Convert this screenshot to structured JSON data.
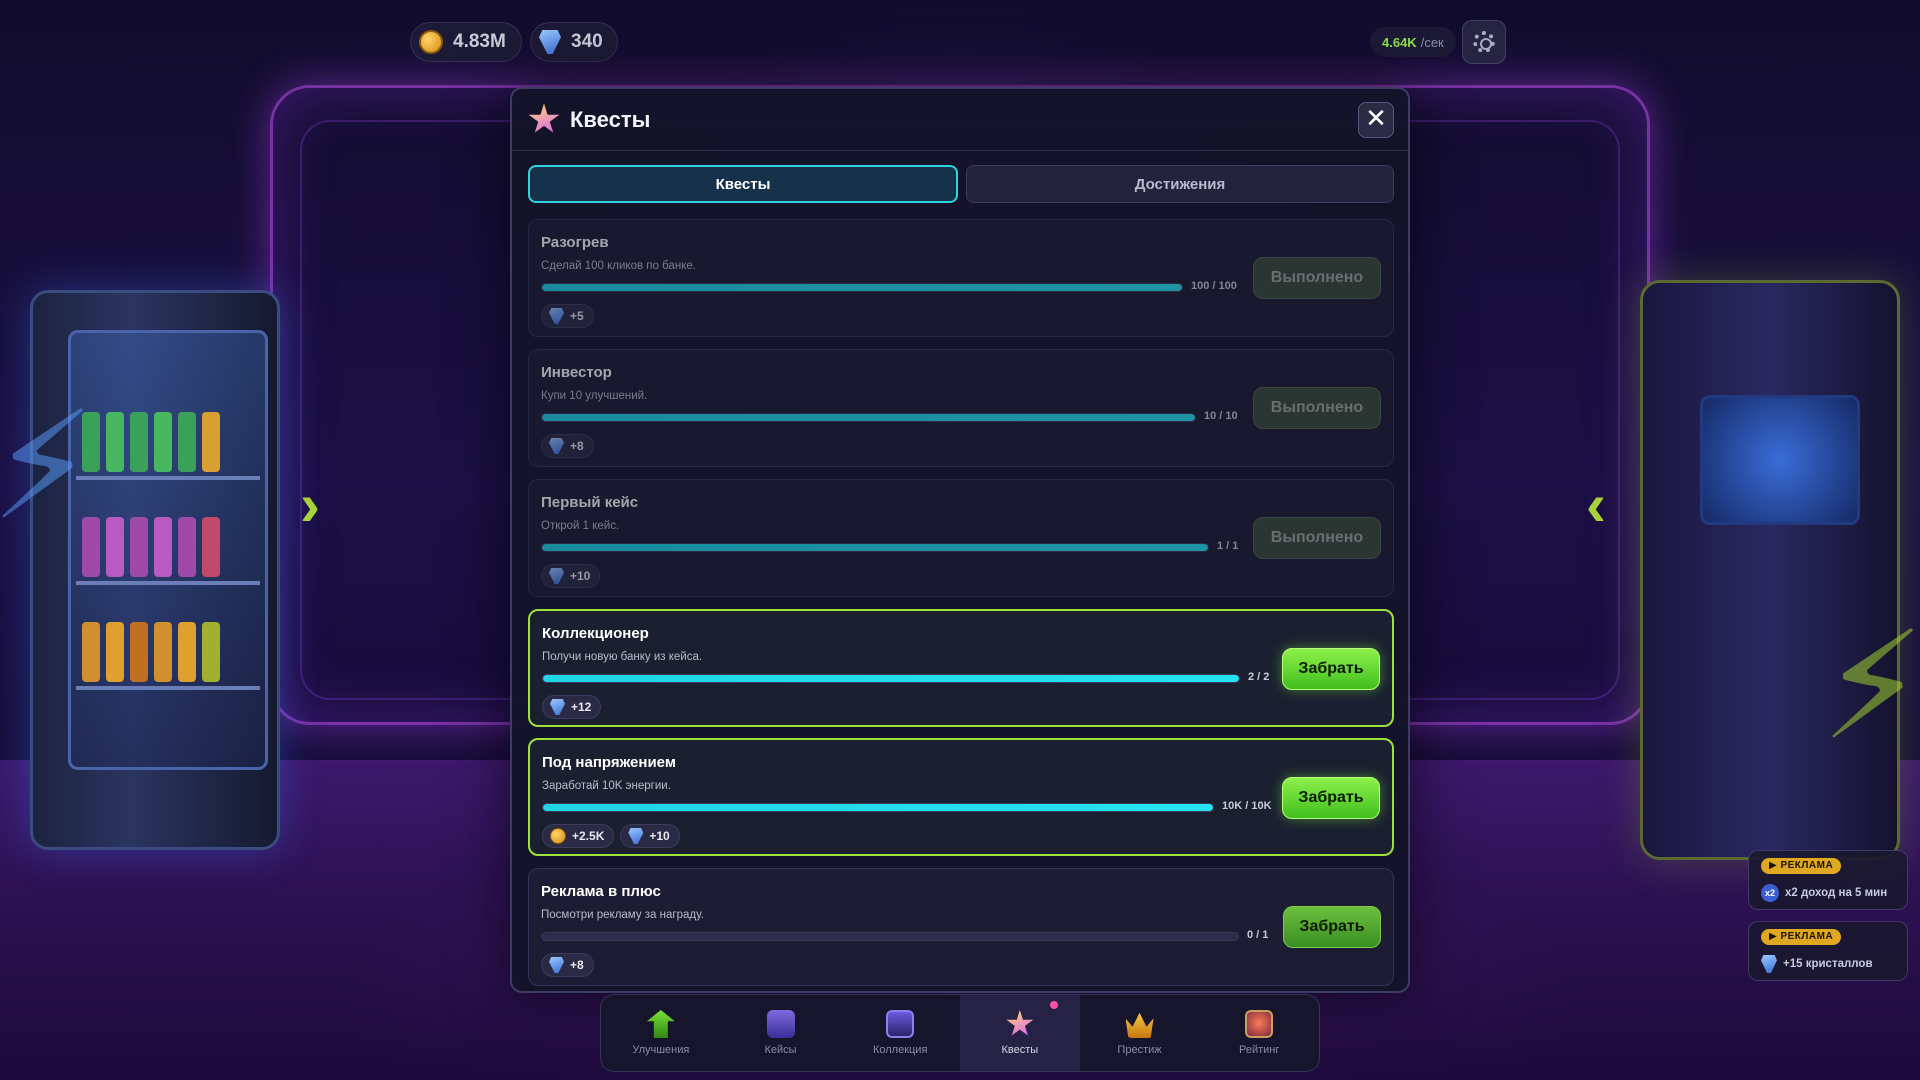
{
  "hud": {
    "coins": "4.83M",
    "crystals": "340",
    "rate_value": "4.64K",
    "rate_unit": "/сек"
  },
  "modal": {
    "title": "Квесты",
    "close": "✕",
    "tabs": [
      {
        "label": "Квесты",
        "active": true
      },
      {
        "label": "Достижения",
        "active": false
      }
    ],
    "quests": [
      {
        "title": "Разогрев",
        "desc": "Сделай 100 кликов по банке.",
        "progress_text": "100 / 100",
        "progress": 1.0,
        "state": "done",
        "button": "Выполнено",
        "rewards": [
          {
            "type": "crystal",
            "text": "+5"
          }
        ]
      },
      {
        "title": "Инвестор",
        "desc": "Купи 10 улучшений.",
        "progress_text": "10 / 10",
        "progress": 1.0,
        "state": "done",
        "button": "Выполнено",
        "rewards": [
          {
            "type": "crystal",
            "text": "+8"
          }
        ]
      },
      {
        "title": "Первый кейс",
        "desc": "Открой 1 кейс.",
        "progress_text": "1 / 1",
        "progress": 1.0,
        "state": "done",
        "button": "Выполнено",
        "rewards": [
          {
            "type": "crystal",
            "text": "+10"
          }
        ]
      },
      {
        "title": "Коллекционер",
        "desc": "Получи новую банку из кейса.",
        "progress_text": "2 / 2",
        "progress": 1.0,
        "state": "claimable",
        "button": "Забрать",
        "rewards": [
          {
            "type": "crystal",
            "text": "+12"
          }
        ]
      },
      {
        "title": "Под напряжением",
        "desc": "Заработай 10K энергии.",
        "progress_text": "10K / 10K",
        "progress": 1.0,
        "state": "claimable",
        "button": "Забрать",
        "rewards": [
          {
            "type": "coin",
            "text": "+2.5K"
          },
          {
            "type": "crystal",
            "text": "+10"
          }
        ]
      },
      {
        "title": "Реклама в плюс",
        "desc": "Посмотри рекламу за награду.",
        "progress_text": "0 / 1",
        "progress": 0.0,
        "state": "ad",
        "button": "Забрать",
        "rewards": [
          {
            "type": "crystal",
            "text": "+8"
          }
        ]
      }
    ]
  },
  "nav": [
    {
      "label": "Улучшения",
      "icon": "upgrade-arrow-icon",
      "active": false
    },
    {
      "label": "Кейсы",
      "icon": "case-icon",
      "active": false
    },
    {
      "label": "Коллекция",
      "icon": "collection-icon",
      "active": false
    },
    {
      "label": "Квесты",
      "icon": "star-icon",
      "active": true
    },
    {
      "label": "Престиж",
      "icon": "crown-icon",
      "active": false
    },
    {
      "label": "Рейтинг",
      "icon": "medal-icon",
      "active": false
    }
  ],
  "ads": [
    {
      "badge": "▶ РЕКЛАМА",
      "text": "x2 доход на 5 мин",
      "icon": "x2-icon",
      "icon_text": "x2"
    },
    {
      "badge": "▶ РЕКЛАМА",
      "text": "+15 кристаллов",
      "icon": "crystal-icon"
    }
  ],
  "colors": {
    "accent_cyan": "#25e3f0",
    "claim_green": "#8ef04a",
    "highlight_border": "#9be23a",
    "ad_badge": "#e0a820"
  }
}
